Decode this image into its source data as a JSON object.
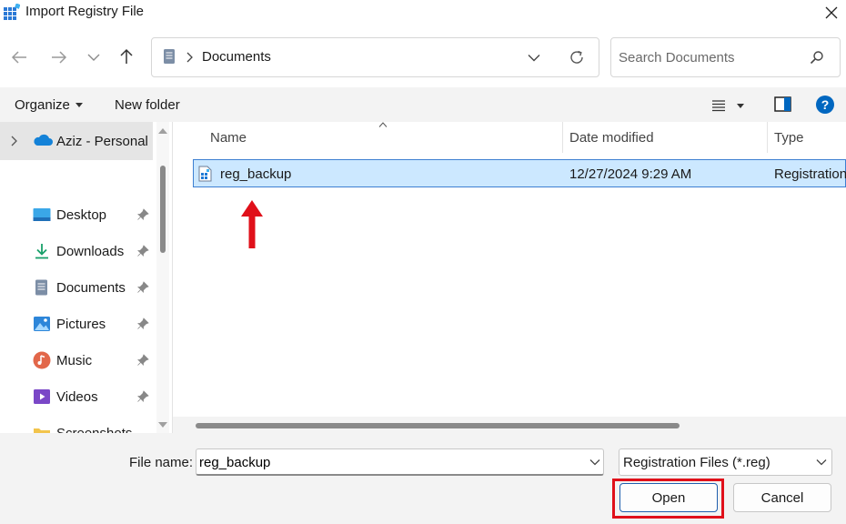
{
  "window": {
    "title": "Import Registry File",
    "icon": "registry-editor-icon"
  },
  "nav": {
    "back": "back-arrow-icon",
    "forward": "forward-arrow-icon",
    "recent": "chevron-down-icon",
    "up": "up-arrow-icon",
    "refresh": "refresh-icon"
  },
  "address": {
    "folder": "Documents"
  },
  "search": {
    "placeholder": "Search Documents"
  },
  "toolbar": {
    "organize_label": "Organize",
    "new_folder_label": "New folder"
  },
  "sidebar": {
    "account": "Aziz - Personal",
    "items": [
      {
        "label": "Desktop",
        "icon": "desktop-icon"
      },
      {
        "label": "Downloads",
        "icon": "downloads-icon"
      },
      {
        "label": "Documents",
        "icon": "documents-icon"
      },
      {
        "label": "Pictures",
        "icon": "pictures-icon"
      },
      {
        "label": "Music",
        "icon": "music-icon"
      },
      {
        "label": "Videos",
        "icon": "videos-icon"
      },
      {
        "label": "Screenshots",
        "icon": "folder-icon"
      }
    ]
  },
  "columns": {
    "name": "Name",
    "date": "Date modified",
    "type": "Type"
  },
  "files": [
    {
      "name": "reg_backup",
      "date": "12/27/2024 9:29 AM",
      "type": "Registration"
    }
  ],
  "footer": {
    "file_name_label": "File name:",
    "file_name_value": "reg_backup",
    "file_type": "Registration Files (*.reg)",
    "open_label": "Open",
    "cancel_label": "Cancel"
  },
  "colors": {
    "selection": "#cce8ff",
    "selection_border": "#3d7fd1",
    "annotation_red": "#e0101a",
    "accent": "#0067c0"
  }
}
